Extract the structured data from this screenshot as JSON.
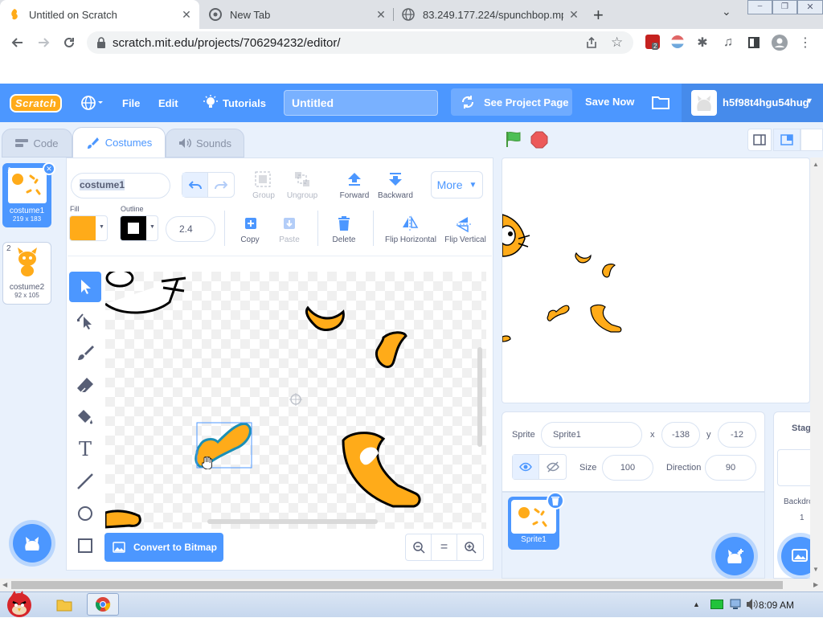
{
  "browser": {
    "tabs": [
      {
        "title": "Untitled on Scratch"
      },
      {
        "title": "New Tab"
      },
      {
        "title": "83.249.177.224/spunchbop.mp"
      }
    ],
    "url": "scratch.mit.edu/projects/706294232/editor/",
    "extension_badge": "2"
  },
  "menubar": {
    "logo": "Scratch",
    "file": "File",
    "edit": "Edit",
    "tutorials": "Tutorials",
    "project_title": "Untitled",
    "see_project_page": "See Project Page",
    "save_now": "Save Now",
    "username": "h5f98t4hgu54hug"
  },
  "editor_tabs": {
    "code": "Code",
    "costumes": "Costumes",
    "sounds": "Sounds"
  },
  "costumes": [
    {
      "index": "1",
      "name": "costume1",
      "size": "219 x 183",
      "selected": true
    },
    {
      "index": "2",
      "name": "costume2",
      "size": "92 x 105",
      "selected": false
    }
  ],
  "paint": {
    "costume_name": "costume1",
    "group": "Group",
    "ungroup": "Ungroup",
    "forward": "Forward",
    "backward": "Backward",
    "more": "More",
    "fill_label": "Fill",
    "outline_label": "Outline",
    "fill_color": "#ffab19",
    "outline_color": "#000000",
    "outline_width": "2.4",
    "copy": "Copy",
    "paste": "Paste",
    "delete": "Delete",
    "flip_horizontal": "Flip Horizontal",
    "flip_vertical": "Flip Vertical",
    "convert_to_bitmap": "Convert to Bitmap"
  },
  "sprite": {
    "label": "Sprite",
    "name": "Sprite1",
    "x_label": "x",
    "x": "-138",
    "y_label": "y",
    "y": "-12",
    "size_label": "Size",
    "size": "100",
    "direction_label": "Direction",
    "direction": "90",
    "thumb_name": "Sprite1"
  },
  "stage_pane": {
    "label": "Stage",
    "backdrops_label": "Backdro",
    "backdrops_count": "1"
  },
  "taskbar": {
    "time": "8:09 AM"
  },
  "colors": {
    "scratch_blue": "#4c97ff",
    "costume_orange": "#ffab19",
    "selection_teal": "#1b8fb5"
  }
}
